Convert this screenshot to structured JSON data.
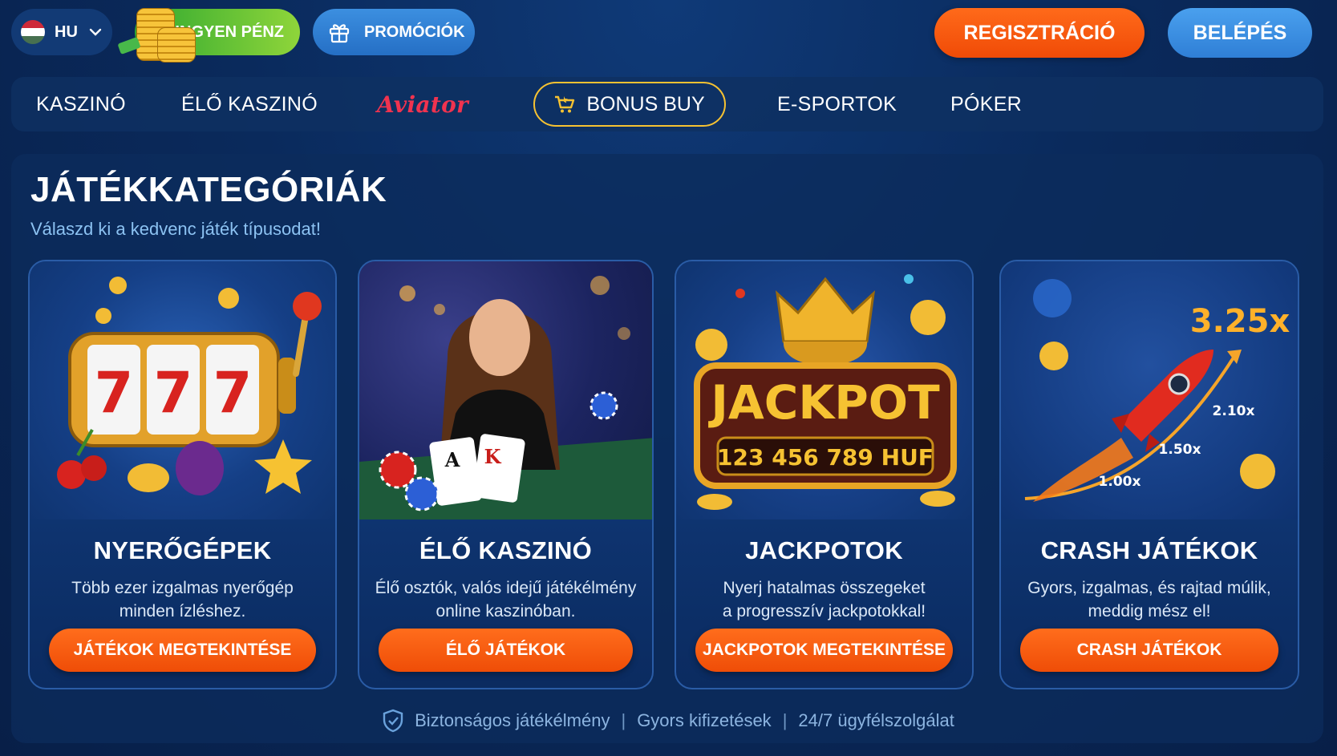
{
  "header": {
    "language": {
      "code": "HU",
      "flag_colors": [
        "#ce2939",
        "#ffffff",
        "#477050"
      ]
    },
    "free_money_label": "INGYEN PÉNZ",
    "promotions_label": "PROMÓCIÓK",
    "register_label": "REGISZTRÁCIÓ",
    "login_label": "BELÉPÉS"
  },
  "nav": {
    "items": [
      {
        "label": "KASZINÓ"
      },
      {
        "label": "ÉLŐ KASZINÓ"
      },
      {
        "label": "Aviator"
      },
      {
        "label": "BONUS BUY"
      },
      {
        "label": "E-SPORTOK"
      },
      {
        "label": "PÓKER"
      }
    ]
  },
  "main": {
    "title": "JÁTÉKKATEGÓRIÁK",
    "subtitle": "Válaszd ki a kedvenc játék típusodat!",
    "cards": [
      {
        "title": "NYERŐGÉPEK",
        "desc_line1": "Több ezer izgalmas nyerőgép",
        "desc_line2": "minden ízléshez.",
        "button": "JÁTÉKOK MEGTEKINTÉSE",
        "image": {
          "reels": [
            "7",
            "7",
            "7"
          ]
        }
      },
      {
        "title": "ÉLŐ KASZINÓ",
        "desc_line1": "Élő osztók, valós idejű játékélmény",
        "desc_line2": "online kaszinóban.",
        "button": "ÉLŐ JÁTÉKOK",
        "image": {
          "cards": [
            "A",
            "K"
          ]
        }
      },
      {
        "title": "JACKPOTOK",
        "desc_line1": "Nyerj hatalmas összegeket",
        "desc_line2": "a progresszív jackpotokkal!",
        "button": "JACKPOTOK MEGTEKINTÉSE",
        "image": {
          "sign": "JACKPOT",
          "amount": "123 456 789 HUF"
        }
      },
      {
        "title": "CRASH JÁTÉKOK",
        "desc_line1": "Gyors, izgalmas, és rajtad múlik,",
        "desc_line2": "meddig mész el!",
        "button": "CRASH JÁTÉKOK",
        "image": {
          "multiplier": "3.25x",
          "marks": [
            "2.10x",
            "1.50x",
            "1.00x"
          ]
        }
      }
    ]
  },
  "footer": {
    "items": [
      "Biztonságos játékélmény",
      "Gyors kifizetések",
      "24/7 ügyfélszolgálat"
    ],
    "separator": "|"
  },
  "colors": {
    "accent_orange": "#f25a0e",
    "accent_blue": "#3388e0",
    "accent_green": "#5cc034",
    "gold": "#f6c232",
    "background": "#0a2a5c"
  }
}
